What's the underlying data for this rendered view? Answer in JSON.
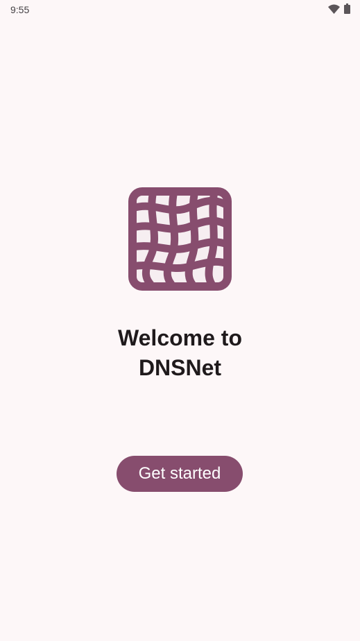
{
  "status_bar": {
    "time": "9:55",
    "icons": [
      "wifi-icon",
      "battery-icon"
    ]
  },
  "onboarding": {
    "logo_icon": "net-grid-logo-icon",
    "welcome_line1": "Welcome to",
    "welcome_line2": "DNSNet",
    "get_started_label": "Get started"
  },
  "colors": {
    "background": "#fdf7f8",
    "accent": "#874d6e",
    "logo_inner": "#f6eef1",
    "text": "#1f1a1c"
  }
}
